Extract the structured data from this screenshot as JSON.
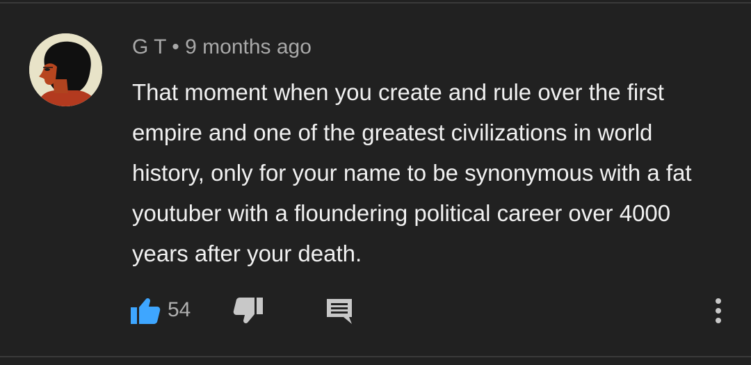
{
  "comment": {
    "author": "G T",
    "separator": "•",
    "timestamp": "9 months ago",
    "text": "That moment when you create and rule over the first empire and one of the greatest civilizations in world history, only for your name to be synonymous with a fat youtuber with a floundering political career over 4000 years after your death.",
    "like_count": "54"
  },
  "icons": {
    "like": "thumbs-up-icon",
    "dislike": "thumbs-down-icon",
    "reply": "comment-reply-icon",
    "more": "more-vertical-icon"
  },
  "colors": {
    "background": "#212121",
    "text": "#f1f1f1",
    "meta_text": "#a9a9a9",
    "like_active": "#3ea6ff",
    "icon_gray": "#c8c8c8"
  }
}
